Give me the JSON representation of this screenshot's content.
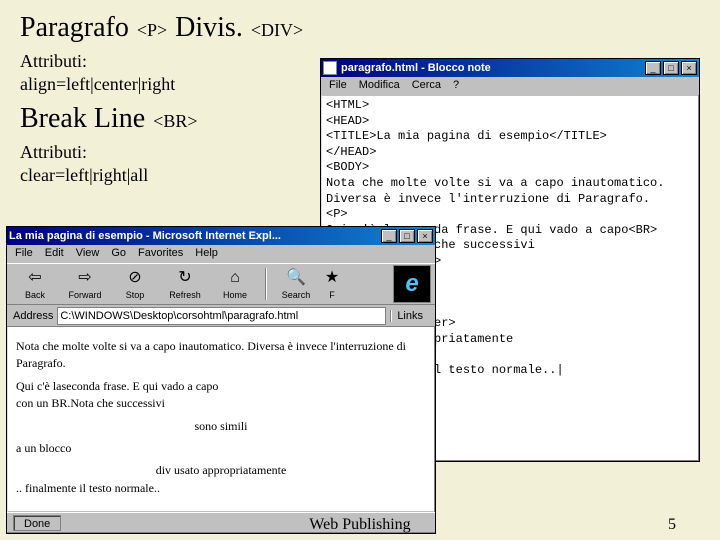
{
  "heading": {
    "para_word": "Paragrafo",
    "para_tag": "<P>",
    "div_word": "Divis.",
    "div_tag": "<DIV>"
  },
  "attr_p_line1": "Attributi:",
  "attr_p_line2": "align=left|center|right",
  "break_line": {
    "word": "Break Line",
    "tag": "<BR>"
  },
  "attr_br_line1": "Attributi:",
  "attr_br_line2": "clear=left|right|all",
  "notepad": {
    "title": "paragrafo.html - Blocco note",
    "menu": [
      "File",
      "Modifica",
      "Cerca",
      "?"
    ],
    "content": "<HTML>\n<HEAD>\n<TITLE>La mia pagina di esempio</TITLE>\n</HEAD>\n<BODY>\nNota che molte volte si va a capo inautomatico.\nDiversa è invece l'interruzione di Paragrafo.\n<P>\nQui c'è laseconda frase. E qui vado a capo<BR>\ncon un BR.Nota che successivi\n<P ALIGN=center>\nsono simili\n<P ALIGN=left>\na un blocco\n<DIV ALIGN=center>\ndiv usato appropriatamente\n</DIV>\n.. finalmente il testo normale..|\n</BODY>\n</HTML>"
  },
  "ie": {
    "title": "La mia pagina di esempio - Microsoft Internet Expl...",
    "menu": [
      "File",
      "Edit",
      "View",
      "Go",
      "Favorites",
      "Help"
    ],
    "toolbar": {
      "back": "Back",
      "forward": "Forward",
      "stop": "Stop",
      "refresh": "Refresh",
      "home": "Home",
      "search": "Search",
      "favs": "F"
    },
    "addr_label": "Address",
    "addr_value": "C:\\WINDOWS\\Desktop\\corsohtml\\paragrafo.html",
    "links_label": "Links",
    "body": {
      "p1": "Nota che molte volte si va a capo inautomatico. Diversa è invece l'interruzione di Paragrafo.",
      "p2": "Qui c'è laseconda frase. E qui vado a capo\ncon un BR.Nota che successivi",
      "p3": "sono simili",
      "p4": "a un blocco",
      "p5": "div usato appropriatamente",
      "p6": ".. finalmente il testo normale.."
    },
    "status": "Done"
  },
  "footer": {
    "label": "Web Publishing",
    "page": "5"
  }
}
